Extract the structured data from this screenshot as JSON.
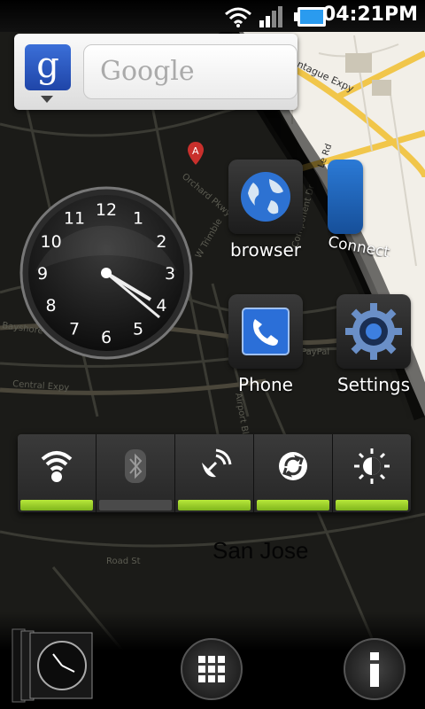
{
  "status_bar": {
    "time": "04:21PM",
    "battery_color": "#2a9bef"
  },
  "search_widget": {
    "logo_letter": "g",
    "placeholder": "Google"
  },
  "clock": {
    "numbers": [
      "12",
      "1",
      "2",
      "3",
      "4",
      "5",
      "6",
      "7",
      "8",
      "9",
      "10",
      "11"
    ],
    "hour_hand": "4:21",
    "minute_hand": "21"
  },
  "apps": [
    {
      "label": "browser",
      "icon": "globe-icon"
    },
    {
      "label": "Connect",
      "icon": "connect-icon"
    },
    {
      "label": "Phone",
      "icon": "phone-icon"
    },
    {
      "label": "Settings",
      "icon": "gear-icon"
    }
  ],
  "toggles": [
    {
      "name": "wifi",
      "state": "on"
    },
    {
      "name": "bluetooth",
      "state": "off"
    },
    {
      "name": "gps",
      "state": "on"
    },
    {
      "name": "sync",
      "state": "on"
    },
    {
      "name": "brightness",
      "state": "on"
    }
  ],
  "map": {
    "city_label": "San Jose",
    "street_labels": [
      "Montague Expy",
      "Bayshore",
      "Central Expy",
      "Airport Blvd",
      "PayPal",
      "W Trimble",
      "Orchard Pkwy",
      "Road St",
      "Le Rd",
      "Component Dr"
    ]
  },
  "dock": {
    "apps_button": "apps-grid-icon",
    "info_button": "info-icon"
  },
  "colors": {
    "accent_green": "#9bd12a",
    "map_road": "#f1c64a"
  }
}
